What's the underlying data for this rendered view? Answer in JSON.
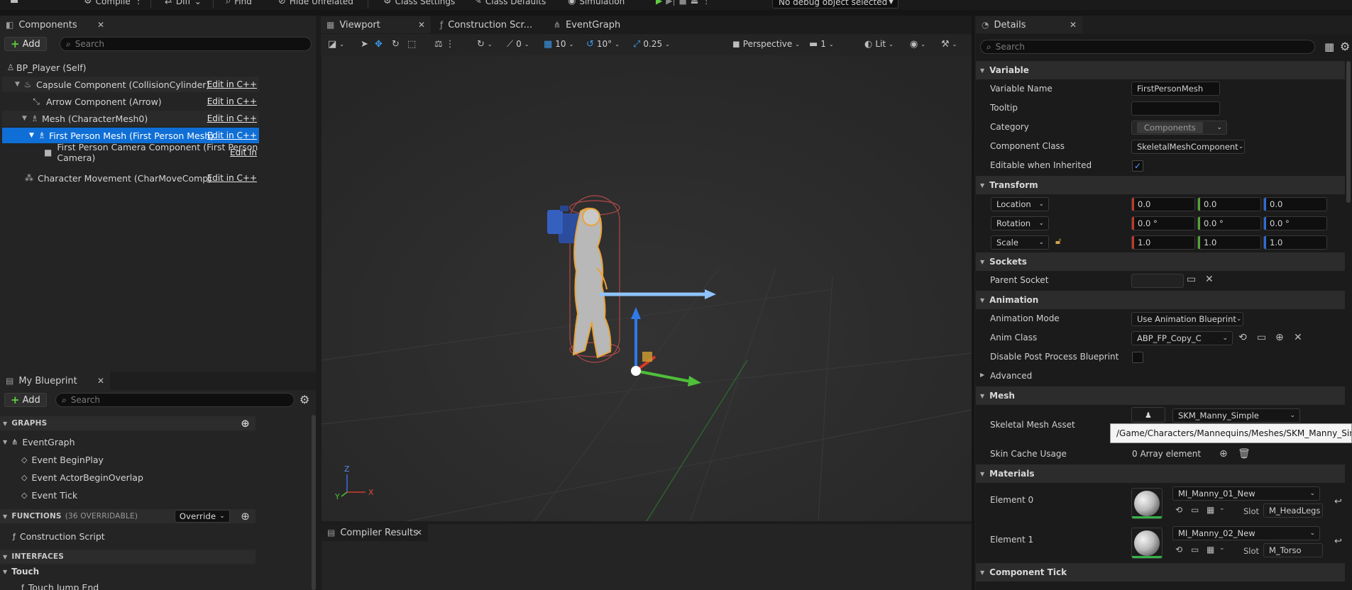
{
  "toolbar": {
    "compile": "Compile",
    "diff": "Diff",
    "find": "Find",
    "hide_unrelated": "Hide Unrelated",
    "class_settings": "Class Settings",
    "class_defaults": "Class Defaults",
    "simulation": "Simulation",
    "debug_object": "No debug object selected"
  },
  "components": {
    "tab": "Components",
    "add": "Add",
    "search_placeholder": "Search",
    "edit_label": "Edit in C++",
    "edit_label_short": "Edit in",
    "root": "BP_Player (Self)",
    "items": [
      {
        "label": "Capsule Component (CollisionCylinder)"
      },
      {
        "label": "Arrow Component (Arrow)"
      },
      {
        "label": "Mesh (CharacterMesh0)"
      },
      {
        "label": "First Person Mesh (First Person Mesh)"
      },
      {
        "label": "First Person Camera Component (First Person Camera)"
      },
      {
        "label": "Character Movement (CharMoveComp)"
      }
    ]
  },
  "my_blueprint": {
    "tab": "My Blueprint",
    "add": "Add",
    "search_placeholder": "Search",
    "graphs_header": "GRAPHS",
    "event_graph": "EventGraph",
    "events": [
      "Event BeginPlay",
      "Event ActorBeginOverlap",
      "Event Tick"
    ],
    "functions_header": "FUNCTIONS",
    "functions_count": "(36 OVERRIDABLE)",
    "override": "Override",
    "construction_script": "Construction Script",
    "interfaces_header": "INTERFACES",
    "touch_header": "Touch",
    "touch_item": "Touch Jump End"
  },
  "editor_tabs": {
    "viewport": "Viewport",
    "construction": "Construction Scr...",
    "event_graph": "EventGraph"
  },
  "viewport": {
    "angle_snap": "0",
    "grid_snap": "10",
    "rotation_snap": "10°",
    "scale_snap": "0.25",
    "perspective": "Perspective",
    "camera_speed": "1",
    "lit": "Lit",
    "axis_z": "Z",
    "axis_y": "Y",
    "axis_x": "X"
  },
  "compiler_results": {
    "tab": "Compiler Results"
  },
  "details": {
    "tab": "Details",
    "search_placeholder": "Search",
    "variable": {
      "header": "Variable",
      "name_label": "Variable Name",
      "name_value": "FirstPersonMesh",
      "tooltip_label": "Tooltip",
      "tooltip_value": "",
      "category_label": "Category",
      "category_value": "Components",
      "class_label": "Component Class",
      "class_value": "SkeletalMeshComponent",
      "editable_label": "Editable when Inherited"
    },
    "transform": {
      "header": "Transform",
      "location": "Location",
      "rotation": "Rotation",
      "scale": "Scale",
      "loc": [
        "0.0",
        "0.0",
        "0.0"
      ],
      "rot": [
        "0.0 °",
        "0.0 °",
        "0.0 °"
      ],
      "scl": [
        "1.0",
        "1.0",
        "1.0"
      ]
    },
    "sockets": {
      "header": "Sockets",
      "parent_socket": "Parent Socket"
    },
    "animation": {
      "header": "Animation",
      "mode_label": "Animation Mode",
      "mode_value": "Use Animation Blueprint",
      "anim_class_label": "Anim Class",
      "anim_class_value": "ABP_FP_Copy_C",
      "disable_pp_label": "Disable Post Process Blueprint",
      "advanced": "Advanced"
    },
    "mesh": {
      "header": "Mesh",
      "asset_label": "Skeletal Mesh Asset",
      "asset_value": "SKM_Manny_Simple",
      "asset_path": "/Game/Characters/Mannequins/Meshes/SKM_Manny_Simple",
      "skin_cache_label": "Skin Cache Usage",
      "skin_cache_value": "0 Array element"
    },
    "materials": {
      "header": "Materials",
      "elements": [
        {
          "label": "Element 0",
          "material": "MI_Manny_01_New",
          "slot_label": "Slot",
          "slot": "M_HeadLegs"
        },
        {
          "label": "Element 1",
          "material": "MI_Manny_02_New",
          "slot_label": "Slot",
          "slot": "M_Torso"
        }
      ]
    },
    "component_tick": {
      "header": "Component Tick"
    }
  }
}
